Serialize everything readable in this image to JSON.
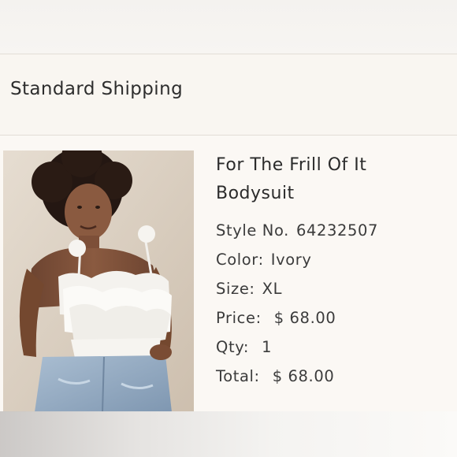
{
  "shipping": {
    "method_label": "Standard Shipping"
  },
  "product": {
    "image_alt": "model wearing white ruffled bodysuit with jeans",
    "title": "For The Frill Of It Bodysuit",
    "style_label": "Style No.",
    "style_value": "64232507",
    "color_label": "Color:",
    "color_value": "Ivory",
    "size_label": "Size:",
    "size_value": "XL",
    "price_label": "Price:",
    "price_value": "$ 68.00",
    "qty_label": "Qty:",
    "qty_value": "1",
    "total_label": "Total:",
    "total_value": "$ 68.00"
  },
  "colors": {
    "background": "#fbf8f4",
    "divider": "#e2ddd6",
    "text": "#2b2b2b"
  }
}
